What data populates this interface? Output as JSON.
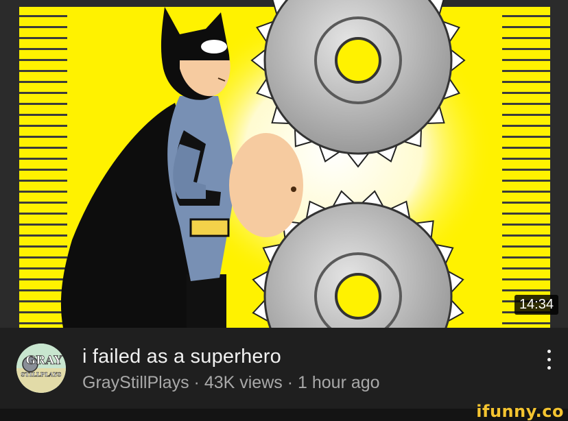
{
  "video": {
    "duration": "14:34",
    "title": "i failed as a superhero",
    "channel": "GrayStillPlays",
    "views": "43K views",
    "age": "1 hour ago",
    "separator": "·"
  },
  "avatar": {
    "text_top": "GRAY",
    "text_bottom": "STILLPLAYS"
  },
  "menu_icon": "more-vert-icon",
  "watermark": "ifunny.co",
  "colors": {
    "background": "#1f1f1f",
    "thumbnail_yellow": "#fff200",
    "title_text": "#f1f1f1",
    "secondary_text": "#a9a9a9",
    "watermark": "#f4c430"
  }
}
